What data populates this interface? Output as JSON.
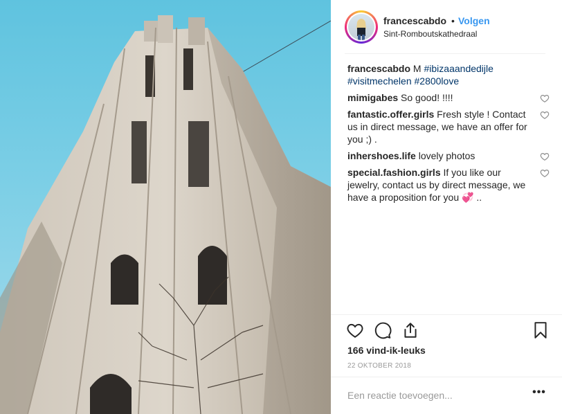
{
  "post": {
    "username": "francescabdo",
    "separator": "•",
    "follow_label": "Volgen",
    "location": "Sint-Romboutskathedraal"
  },
  "caption": {
    "username": "francescabdo",
    "text": " M ",
    "hashtags": [
      "#ibizaaandedijle",
      "#visitmechelen",
      "#2800love"
    ]
  },
  "comments": [
    {
      "username": "mimigabes",
      "text": " So good! !!!!"
    },
    {
      "username": "fantastic.offer.girls",
      "text": " Fresh style ! Contact us in direct message, we have an offer for you ;) ."
    },
    {
      "username": "inhershoes.life",
      "text": " lovely photos"
    },
    {
      "username": "special.fashion.girls",
      "text": " If you like our jewelry, contact us by direct message, we have a proposition for you 💞 .."
    }
  ],
  "likes_text": "166 vind-ik-leuks",
  "date_text": "22 OKTOBER 2018",
  "comment_input": {
    "placeholder": "Een reactie toevoegen..."
  },
  "more_label": "•••",
  "icons": {
    "like": "heart-icon",
    "comment": "comment-icon",
    "share": "share-icon",
    "save": "bookmark-icon",
    "comment_like": "heart-outline-icon"
  },
  "colors": {
    "accent": "#3897f0",
    "hashtag": "#003569",
    "text": "#262626",
    "muted": "#999999",
    "divider": "#efefef"
  }
}
